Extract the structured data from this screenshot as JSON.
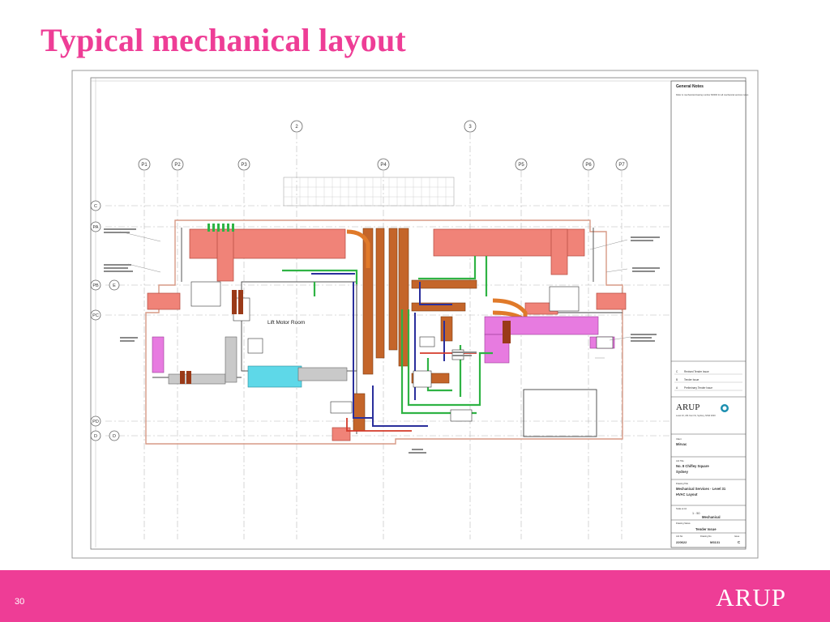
{
  "slide": {
    "title": "Typical mechanical layout",
    "page_number": "30",
    "brand": "ARUP"
  },
  "drawing": {
    "grid_columns": [
      "2",
      "3",
      "P1",
      "P2",
      "P3",
      "P4",
      "P5",
      "P6",
      "P7"
    ],
    "grid_rows": [
      "C",
      "PA",
      "PB",
      "E",
      "PC",
      "PD",
      "D",
      "D"
    ],
    "room_label": "Lift Motor Room",
    "notes_heading": "General Notes",
    "notes_text": "Refer to mechanical drawing number M0000 for all mechanical services notes",
    "revisions": [
      {
        "rev": "C",
        "description": "Revised Tender Issue"
      },
      {
        "rev": "B",
        "description": "Tender Issue"
      },
      {
        "rev": "A",
        "description": "Preliminary Tender Issue"
      }
    ],
    "company": "ARUP",
    "company_address": "Level 10, 201 Kent St, Sydney, NSW 2000",
    "client_label": "Client",
    "client": "Mirvac",
    "job_title_label": "Job Title",
    "job_title_1": "No. 8 Chifley Square",
    "job_title_2": "Sydney",
    "drawing_title_label": "Drawing Title",
    "drawing_title_1": "Mechanical Services - Level 31",
    "drawing_title_2": "HVAC Layout",
    "scale_label": "Scale at A1",
    "scale": "1 : 50",
    "discipline_label": "Discipline",
    "discipline": "Mechanical",
    "status_label": "Drawing Status",
    "status": "Tender Issue",
    "job_no_label": "Job No",
    "job_no": "220622",
    "drawing_no_label": "Drawing No",
    "drawing_no": "M3131",
    "issue_label": "Issue",
    "issue": "C"
  },
  "colors": {
    "accent_pink": "#ee3d96",
    "duct_salmon": "#f08378",
    "pipe_green": "#2fb344",
    "pipe_blue": "#2a2f9c",
    "pipe_orange": "#d86a1e",
    "duct_cyan": "#5ed8e8",
    "duct_magenta": "#e77be0"
  }
}
